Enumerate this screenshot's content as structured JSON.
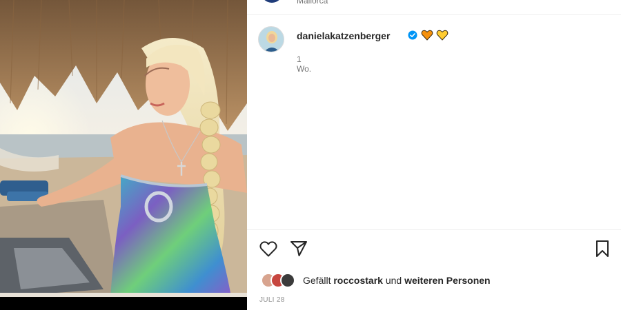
{
  "location": {
    "text": "Mallorca"
  },
  "post": {
    "username": "danielakatzenberger",
    "caption_emojis": "🧡💛",
    "time_ago": "1 Wo.",
    "likes": {
      "prefix": "Gefällt",
      "user": "roccostark",
      "conjunction": "und",
      "others": "weiteren Personen"
    },
    "date": "JULI 28"
  },
  "icons": {
    "like": "heart-icon",
    "share": "paper-plane-icon",
    "save": "bookmark-icon",
    "verified": "verified-badge-icon"
  },
  "colors": {
    "verified": "#0095f6",
    "orange_heart": "#f4900c",
    "yellow_heart": "#ffcc32",
    "text_primary": "#262626",
    "text_secondary": "#737373"
  }
}
